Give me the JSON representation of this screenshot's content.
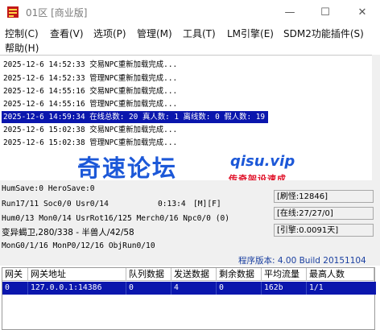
{
  "window": {
    "title": "01区 [商业版]",
    "minimize": "—",
    "maximize": "☐",
    "close": "✕"
  },
  "menu": [
    "控制(C)",
    "查看(V)",
    "选项(P)",
    "管理(M)",
    "工具(T)",
    "LM引擎(E)",
    "SDM2功能插件(S)",
    "帮助(H)"
  ],
  "log": [
    "2025-12-6 14:52:33 交易NPC重新加载完成...",
    "2025-12-6 14:52:33 管理NPC重新加载完成...",
    "2025-12-6 14:55:16 交易NPC重新加载完成...",
    "2025-12-6 14:55:16 管理NPC重新加载完成...",
    "2025-12-6 14:59:34 在线总数: 20 真人数: 1 离线数: 0 假人数: 19",
    "2025-12-6 15:02:38 交易NPC重新加载完成...",
    "2025-12-6 15:02:38 管理NPC重新加载完成..."
  ],
  "watermark": {
    "cn": "奇速论坛",
    "url": "qisu.vip",
    "sub": "传奇架设速成"
  },
  "status": {
    "save": "HumSave:0 HeroSave:0",
    "run": "Run17/11 Soc0/0 Usr0/14",
    "time": "0:13:4",
    "modes": "[M][F]",
    "hum": "Hum0/13 Mon0/14 UsrRot16/125 Merch0/16 Npc0/0 (0)",
    "monster": "变异蝎卫,280/338 - 半兽人/42/58",
    "mon_gen": "MonG0/1/16 MonP0/12/16 ObjRun0/10",
    "refresh": "[刷怪:12846]",
    "online": "[在线:27/27/0]",
    "engine": "[引擎:0.0091天]",
    "version": "程序版本: 4.00 Build 20151104"
  },
  "table": {
    "headers": [
      "网关",
      "网关地址",
      "队列数据",
      "发送数据",
      "剩余数据",
      "平均流量",
      "最高人数"
    ],
    "rows": [
      [
        "0",
        "127.0.0.1:14386",
        "0",
        "4",
        "0",
        "162b",
        "1/1"
      ]
    ]
  },
  "colors": {
    "selection": "#0a16ad",
    "watermark_blue": "#1c58d8",
    "watermark_red": "#e0132a",
    "version_blue": "#1a3fa0"
  }
}
